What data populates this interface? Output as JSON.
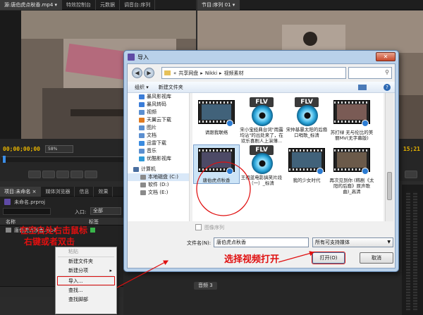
{
  "source_tabs": [
    "源:唐伯虎点秋香.mp4 ▾",
    "特效控制台",
    "元数据",
    "调音台:序列"
  ],
  "program_tab": "节目:序列 01 ▾",
  "source_timecode": "00;00;00;00",
  "source_zoom": "58%",
  "program_timecode_tail": "15;21",
  "project_tabs": [
    "项目:未命名 ×",
    "媒体浏览器",
    "信息",
    "效果"
  ],
  "project": {
    "file_name": "未命名.prproj",
    "entry_label": "入口:",
    "entry_value": "全部",
    "col_name": "名称",
    "col_label": "标签",
    "item_name": "唐伯虎点秋香.mp4"
  },
  "timeline_tab": "音频 3",
  "context_menu": {
    "items": [
      {
        "label": "粘贴",
        "disabled": true
      },
      {
        "label": "新建文件夹",
        "disabled": false
      },
      {
        "label": "新建分项",
        "disabled": false,
        "submenu": true
      },
      {
        "label": "导入...",
        "disabled": false,
        "highlight": true
      },
      {
        "label": "查找...",
        "disabled": false
      },
      {
        "label": "查找脚部",
        "disabled": false
      }
    ]
  },
  "dialog": {
    "title": "导入",
    "breadcrumb": [
      "共享网盘",
      "Nikki",
      "视频素材"
    ],
    "organize": "组织 ▾",
    "new_folder": "新建文件夹",
    "nav_items": [
      {
        "label": "暴风影视库",
        "color": "#3b7dd8"
      },
      {
        "label": "暴风转码",
        "color": "#3b7dd8"
      },
      {
        "label": "视频",
        "color": "#5b8fd0"
      },
      {
        "label": "天翼云下载",
        "color": "#e07a1f"
      },
      {
        "label": "图片",
        "color": "#5b8fd0"
      },
      {
        "label": "文档",
        "color": "#5b8fd0"
      },
      {
        "label": "迅雷下载",
        "color": "#3a8be0"
      },
      {
        "label": "音乐",
        "color": "#5b8fd0"
      },
      {
        "label": "优酷影视库",
        "color": "#2f9ad8"
      },
      {
        "label": "计算机",
        "color": "#4a6fa0"
      },
      {
        "label": "本地磁盘 (C:)",
        "color": "#8a8a8a"
      },
      {
        "label": "软件 (D:)",
        "color": "#8a8a8a"
      },
      {
        "label": "文档 (E:)",
        "color": "#8a8a8a"
      }
    ],
    "files": [
      {
        "label": "请跟我联络",
        "kind": "film"
      },
      {
        "label": "宋小宝经典台词\"雨露均沾\"的出处来了，在欢乐喜剧人上演薄...",
        "kind": "flv"
      },
      {
        "label": "宋仲基暴太阳的后裔口哨歌_标清",
        "kind": "flv"
      },
      {
        "label": "苏打绿 无与伦比的美丽MV(无字幕版)",
        "kind": "film"
      },
      {
        "label": "唐伯虎点秋香",
        "kind": "film",
        "selected": true
      },
      {
        "label": "王祖蓝电影搞笑片段（一）_标清",
        "kind": "flv"
      },
      {
        "label": "我的少女时代",
        "kind": "film"
      },
      {
        "label": "再次见到你 (韩剧《太阳的后裔》原声歌曲)_高清",
        "kind": "film"
      }
    ],
    "image_sequence": "图像序列",
    "filename_label": "文件名(N):",
    "filename_value": "唐伯虎点秋香",
    "filter_value": "所有可支持媒体",
    "open_button": "打开(O)",
    "cancel_button": "取消"
  },
  "annotations": {
    "right_click": "在空白处右击鼠标",
    "double_click": "右键或者双击",
    "select_video": "选择视频打开"
  },
  "colors": {
    "accent_red": "#e01010",
    "timecode": "#e8b400"
  }
}
